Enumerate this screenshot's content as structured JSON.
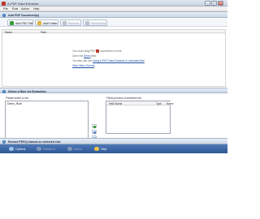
{
  "window": {
    "title": "A-PDF Data Extractor"
  },
  "menu": [
    "File",
    "Rule",
    "Action",
    "Help"
  ],
  "sections": {
    "add": "Add PDF Document(s)",
    "rule": "Select a Rule for Extraction",
    "extract": "Extract PDF(s) based on selected rule"
  },
  "toolbar": {
    "add_pdf": "Add PDF File",
    "add_folder": "Add Folder",
    "remove": "Remove",
    "remove_all": "Remove All"
  },
  "file_list": {
    "columns": [
      "Name",
      "Path"
    ],
    "hint_line1_pre": "You could drag PDF",
    "hint_line1_post": "documents to here",
    "hint_line2_pre": "Open the",
    "hint_line2_link": "Demo",
    "hint_line2_post": "files",
    "hint_line3_pre": "You also can use",
    "hint_line3_link": "Using A-PDF Data Extractor in command line",
    "hint_line4_link": "View Video Tutorial"
  },
  "rules": {
    "label": "Please select a rule:",
    "items": [
      "Demo_Rule"
    ]
  },
  "fields": {
    "label": "Fields preview of selected rule:",
    "columns": [
      "Field Name",
      "Type",
      "Name"
    ]
  },
  "bottom": {
    "options": "Options",
    "extract": "Extract to",
    "action": "Action",
    "help": "Help"
  },
  "colors": {
    "accent": "#2e5797",
    "pdf_red": "#c0392b",
    "add_green": "#3c9a3c",
    "folder_yellow": "#e3b33c"
  }
}
